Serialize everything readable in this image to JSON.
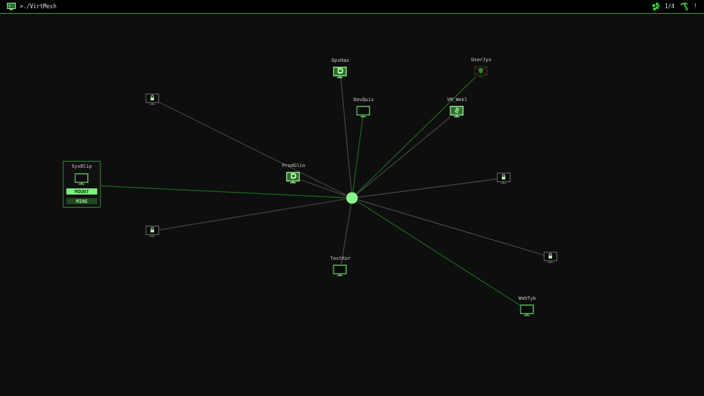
{
  "header": {
    "title": ">./VirtMesh",
    "counter": "1/4",
    "alert": "!"
  },
  "nodes": [
    {
      "name": "OpsHax",
      "kind": "crypto",
      "link_active": false,
      "selected": false
    },
    {
      "name": "UserJyx",
      "kind": "infected",
      "link_active": true,
      "selected": false
    },
    {
      "name": "DevQuix",
      "kind": "empty",
      "link_active": true,
      "selected": false
    },
    {
      "name": "VM_Wekl",
      "kind": "virus",
      "link_active": false,
      "selected": false
    },
    {
      "kind": "locked",
      "link_active": false,
      "selected": false
    },
    {
      "name": "ProdGlin",
      "kind": "crypto",
      "link_active": false,
      "selected": false
    },
    {
      "name": "SysBlip",
      "kind": "empty",
      "link_active": true,
      "selected": true,
      "actions": [
        {
          "label": "MOUNT",
          "highlighted": true
        },
        {
          "label": "MINE",
          "highlighted": false
        }
      ]
    },
    {
      "kind": "locked",
      "link_active": false,
      "selected": false
    },
    {
      "kind": "locked",
      "link_active": false,
      "selected": false
    },
    {
      "name": "TestXor",
      "kind": "empty",
      "link_active": false,
      "selected": false
    },
    {
      "kind": "locked",
      "link_active": false,
      "selected": false
    },
    {
      "name": "WebTyk",
      "kind": "empty",
      "link_active": true,
      "selected": false
    }
  ]
}
